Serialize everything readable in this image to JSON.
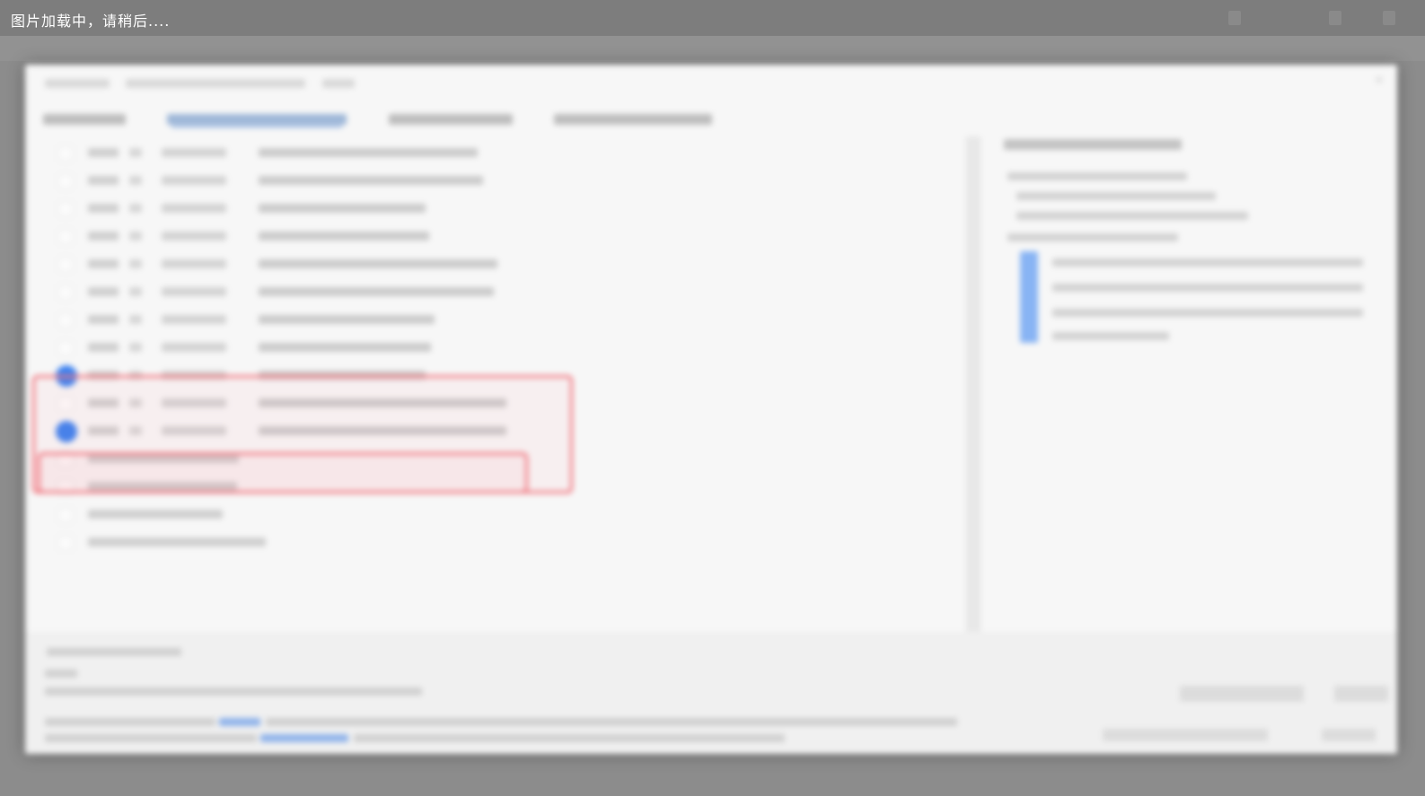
{
  "loading_bar": {
    "message": "图片加载中，请稍后....",
    "background": "#7d7d7d"
  },
  "dialog": {
    "selection_color": "#3d82f0",
    "highlight_color": "#f0757e"
  }
}
